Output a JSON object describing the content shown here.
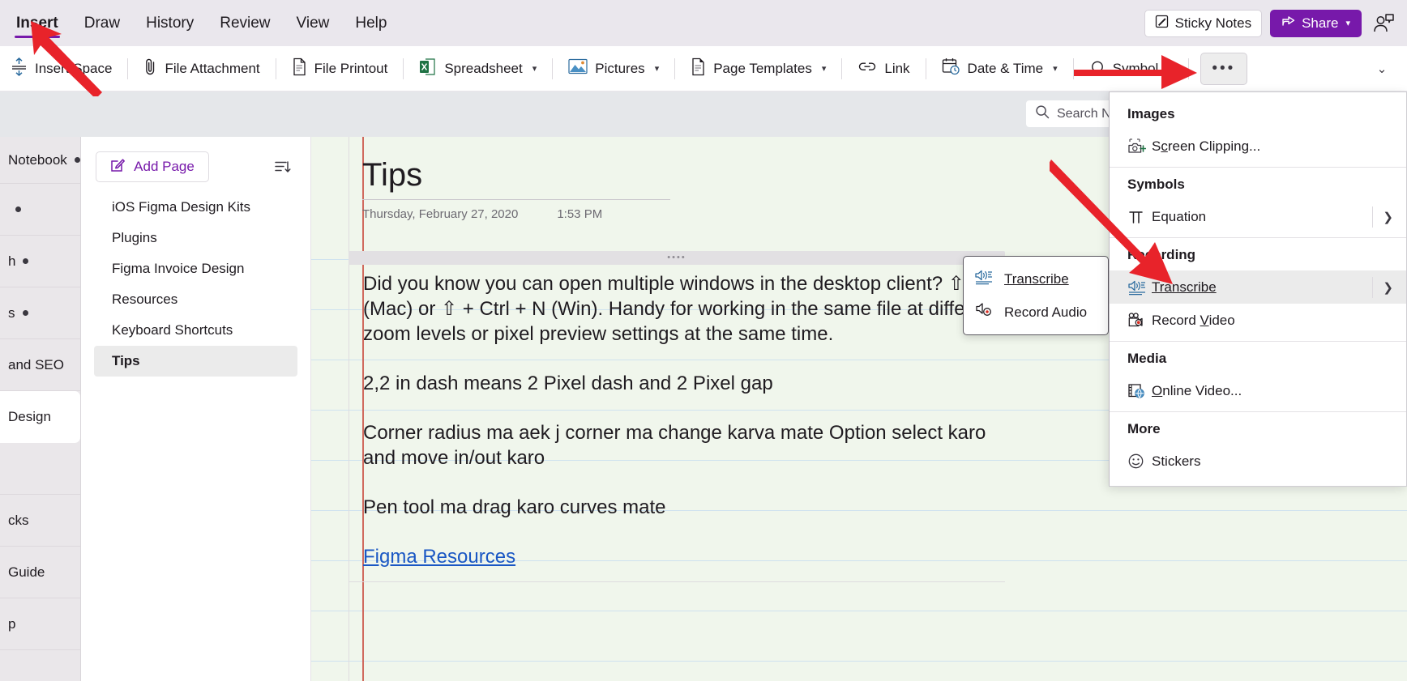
{
  "menubar": {
    "tabs": [
      {
        "label": "Insert",
        "active": true
      },
      {
        "label": "Draw",
        "active": false
      },
      {
        "label": "History",
        "active": false
      },
      {
        "label": "Review",
        "active": false
      },
      {
        "label": "View",
        "active": false
      },
      {
        "label": "Help",
        "active": false
      }
    ],
    "sticky_notes_label": "Sticky Notes",
    "share_label": "Share",
    "accent_color": "#7719aa"
  },
  "ribbon": {
    "items": [
      {
        "label": "Insert Space",
        "icon": "insert-space-icon",
        "caret": false
      },
      {
        "label": "File Attachment",
        "icon": "paperclip-icon",
        "caret": false
      },
      {
        "label": "File Printout",
        "icon": "file-printout-icon",
        "caret": false
      },
      {
        "label": "Spreadsheet",
        "icon": "spreadsheet-icon",
        "caret": true
      },
      {
        "label": "Pictures",
        "icon": "pictures-icon",
        "caret": true
      },
      {
        "label": "Page Templates",
        "icon": "page-templates-icon",
        "caret": true
      },
      {
        "label": "Link",
        "icon": "link-icon",
        "caret": false
      },
      {
        "label": "Date & Time",
        "icon": "date-time-icon",
        "caret": true
      },
      {
        "label": "Symbol",
        "icon": "symbol-icon",
        "caret": true
      }
    ],
    "more_label": "•••",
    "expand_label": "⌄"
  },
  "search": {
    "placeholder": "Search Notebook",
    "value": "Search No"
  },
  "rail": {
    "items": [
      {
        "label": "Notebook",
        "dot": true,
        "selected": false
      },
      {
        "label": "",
        "dot": true,
        "selected": false
      },
      {
        "label": "h",
        "dot": true,
        "selected": false
      },
      {
        "label": "s",
        "dot": true,
        "selected": false
      },
      {
        "label": "and SEO",
        "dot": false,
        "selected": false
      },
      {
        "label": "Design",
        "dot": false,
        "selected": true
      },
      {
        "label": "",
        "dot": false,
        "selected": false
      },
      {
        "label": "cks",
        "dot": false,
        "selected": false
      },
      {
        "label": "Guide",
        "dot": false,
        "selected": false
      },
      {
        "label": "p",
        "dot": false,
        "selected": false
      }
    ]
  },
  "pagelist": {
    "add_page_label": "Add Page",
    "sort_icon": "sort-icon",
    "pages": [
      {
        "title": "iOS Figma Design Kits",
        "active": false
      },
      {
        "title": "Plugins",
        "active": false
      },
      {
        "title": "Figma Invoice Design",
        "active": false
      },
      {
        "title": "Resources",
        "active": false
      },
      {
        "title": "Keyboard Shortcuts",
        "active": false
      },
      {
        "title": "Tips",
        "active": true
      }
    ]
  },
  "note": {
    "title": "Tips",
    "date": "Thursday, February 27, 2020",
    "time": "1:53 PM",
    "paragraphs": [
      {
        "text": "Did you know you can open multiple windows in the desktop client? ⇧ + N (Mac) or ⇧ + Ctrl + N (Win). Handy for working in the same file at different zoom levels or pixel preview settings at the same time.",
        "link": false
      },
      {
        "text": "2,2 in dash means 2 Pixel dash and 2 Pixel gap",
        "link": false
      },
      {
        "text": "Corner radius ma aek j corner ma change karva mate Option select karo and move in/out karo",
        "link": false
      },
      {
        "text": "Pen tool ma drag karo curves mate",
        "link": false
      },
      {
        "text": "Figma Resources",
        "link": true
      }
    ]
  },
  "submenu": {
    "items": [
      {
        "label": "Transcribe",
        "icon": "transcribe-icon",
        "underline_first": true
      },
      {
        "label": "Record Audio",
        "icon": "record-audio-icon",
        "underline_first": false
      }
    ]
  },
  "dropdown": {
    "groups": [
      {
        "header": "Images",
        "items": [
          {
            "label": "Screen Clipping...",
            "icon": "screen-clipping-icon",
            "arrow": false,
            "highlight": false
          }
        ]
      },
      {
        "header": "Symbols",
        "items": [
          {
            "label": "Equation",
            "icon": "equation-icon",
            "arrow": true,
            "highlight": false
          }
        ]
      },
      {
        "header": "Recording",
        "items": [
          {
            "label": "Transcribe",
            "icon": "transcribe-icon",
            "arrow": true,
            "highlight": true
          },
          {
            "label": "Record Video",
            "icon": "record-video-icon",
            "arrow": false,
            "highlight": false
          }
        ]
      },
      {
        "header": "Media",
        "items": [
          {
            "label": "Online Video...",
            "icon": "online-video-icon",
            "arrow": false,
            "highlight": false
          }
        ]
      },
      {
        "header": "More",
        "items": [
          {
            "label": "Stickers",
            "icon": "stickers-icon",
            "arrow": false,
            "highlight": false
          }
        ]
      }
    ]
  },
  "annotations": {
    "arrow_color": "#e8232a",
    "arrows": [
      {
        "name": "arrow-to-insert-tab"
      },
      {
        "name": "arrow-to-more-button"
      },
      {
        "name": "arrow-to-transcribe-item"
      }
    ]
  }
}
